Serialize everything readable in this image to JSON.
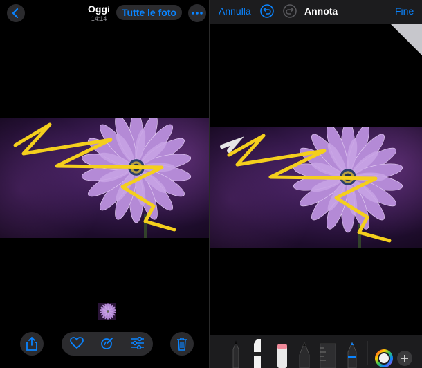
{
  "left": {
    "header": {
      "title": "Oggi",
      "time": "14:14",
      "all_photos": "Tutte le foto"
    },
    "icons": {
      "back": "chevron-left-icon",
      "more": "ellipsis-icon",
      "share": "share-icon",
      "favorite": "heart-icon",
      "edit": "pen-edit-icon",
      "adjust": "sliders-icon",
      "delete": "trash-icon"
    }
  },
  "right": {
    "header": {
      "cancel": "Annulla",
      "title": "Annota",
      "done": "Fine"
    },
    "tools": [
      "pen",
      "marker",
      "eraser",
      "pencil",
      "ruler",
      "colored-pencil",
      "color-wheel",
      "plus"
    ]
  },
  "colors": {
    "accent": "#0a84ff",
    "stroke": "#f4cf1d",
    "bar": "#1c1c1e",
    "pill": "#2b2b2e"
  }
}
